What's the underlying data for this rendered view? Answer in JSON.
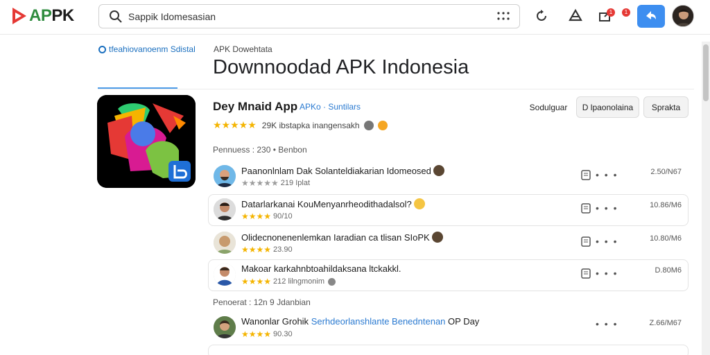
{
  "header": {
    "logo_text_a": "AP",
    "logo_text_b": "PK",
    "search_value": "Sappik Idomesasian",
    "upload_badge": "1",
    "notif_badge": "1"
  },
  "page": {
    "crumb_left": "tfeahiovanoenm Sdistal",
    "crumb_right": "APK  Dowehtata",
    "title": "Downnoodad APK Indonesia"
  },
  "app": {
    "name": "Dey Mnaid App",
    "name_tag": "APKo · Suntilars",
    "rating_stars": "★★★★★",
    "rating_text": "29K ibstapka inangensakh",
    "actions": {
      "secondary": "Sodulguar",
      "download": "D lpaonolaina",
      "share": "Sprakta"
    }
  },
  "sections": {
    "first": "Pennuess : 230  •  Benbon",
    "second": "Penoerat : 12n 9 Jdanbian"
  },
  "reviews": [
    {
      "title": "Paanonlnlam Dak Solanteldiakarian Idomeosed",
      "link": "",
      "stars": "★★★★★",
      "meta": "219 Iplat",
      "size": "2.50/N67",
      "boxed": false
    },
    {
      "title": "Datarlarkanai KouMenyanrheodithadalsol?",
      "link": "",
      "stars": "★★★★",
      "meta": "90/10",
      "size": "10.86/M6",
      "boxed": true
    },
    {
      "title": "Olidecnonenenlemkan Iaradian ca tlisan SIoPK",
      "link": "",
      "stars": "★★★★",
      "meta": "23.90",
      "size": "10.80/M6",
      "boxed": false
    },
    {
      "title": "Makoar karkahnbtoahildaksana ltckakkl.",
      "link": "",
      "stars": "★★★★",
      "meta": "212 lilngmonim",
      "size": "D.80M6",
      "boxed": true
    },
    {
      "title": "Wanonlar Grohik",
      "link": "Serhdeorlanshlante Benedntenan",
      "tail": "OP Day",
      "stars": "★★★★",
      "meta": "90.30",
      "size": "Z.66/M67",
      "boxed": false
    }
  ],
  "colors": {
    "brand_red": "#e53935",
    "brand_green": "#2e8b3d",
    "link_blue": "#2a7ad1",
    "star_yellow": "#f4b400",
    "upload_blue": "#3d8ef0"
  },
  "icons": [
    "search-icon",
    "apps-grid-icon",
    "refresh-icon",
    "store-icon",
    "upload-icon",
    "notification-icon",
    "share-icon",
    "doc-icon",
    "more-icon"
  ]
}
